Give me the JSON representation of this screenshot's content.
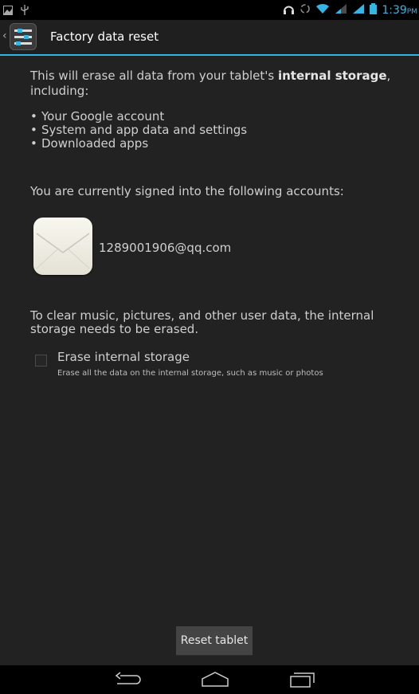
{
  "status_bar": {
    "time": "1:39",
    "ampm": "PM",
    "left_icons": [
      "gallery-notification-icon",
      "usb-icon"
    ],
    "right_icons": [
      "headset-icon",
      "sync-icon",
      "wifi-icon",
      "signal-icon",
      "signal-icon",
      "battery-icon"
    ]
  },
  "action_bar": {
    "title": "Factory data reset",
    "icon": "settings-sliders-icon"
  },
  "content": {
    "intro_prefix": "This will erase all data from your tablet's ",
    "intro_bold": "internal storage",
    "intro_suffix": ", including:",
    "bullets": [
      "Your Google account",
      "System and app data and settings",
      "Downloaded apps"
    ],
    "signed_in_label": "You are currently signed into the following accounts:",
    "account_email": "1289001906@qq.com",
    "clear_note": "To clear music, pictures, and other user data, the internal storage needs to be erased.",
    "erase_option": {
      "title": "Erase internal storage",
      "summary": "Erase all the data on the internal storage, such as music or photos",
      "checked": false
    }
  },
  "reset_button_label": "Reset tablet",
  "nav_bar": [
    "back-icon",
    "home-icon",
    "recent-apps-icon"
  ],
  "colors": {
    "accent": "#33b5e5",
    "background": "#222222"
  }
}
